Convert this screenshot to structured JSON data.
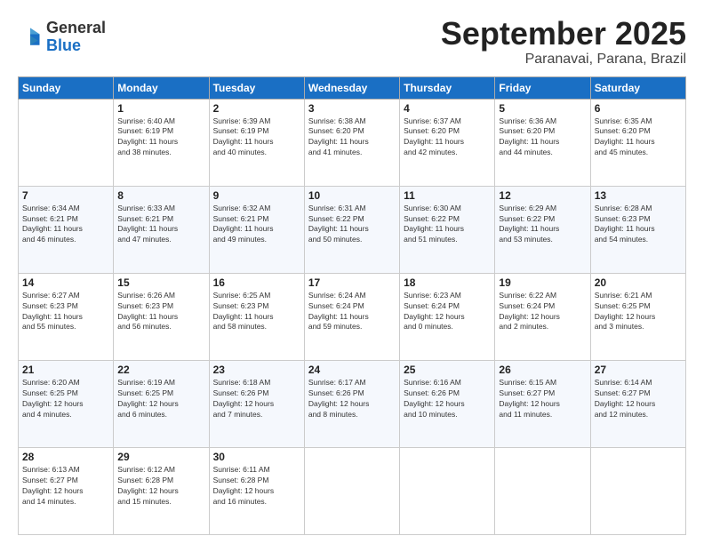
{
  "logo": {
    "general": "General",
    "blue": "Blue"
  },
  "header": {
    "month": "September 2025",
    "location": "Paranavai, Parana, Brazil"
  },
  "weekdays": [
    "Sunday",
    "Monday",
    "Tuesday",
    "Wednesday",
    "Thursday",
    "Friday",
    "Saturday"
  ],
  "weeks": [
    [
      {
        "day": "",
        "sunrise": "",
        "sunset": "",
        "daylight": ""
      },
      {
        "day": "1",
        "sunrise": "Sunrise: 6:40 AM",
        "sunset": "Sunset: 6:19 PM",
        "daylight": "Daylight: 11 hours and 38 minutes."
      },
      {
        "day": "2",
        "sunrise": "Sunrise: 6:39 AM",
        "sunset": "Sunset: 6:19 PM",
        "daylight": "Daylight: 11 hours and 40 minutes."
      },
      {
        "day": "3",
        "sunrise": "Sunrise: 6:38 AM",
        "sunset": "Sunset: 6:20 PM",
        "daylight": "Daylight: 11 hours and 41 minutes."
      },
      {
        "day": "4",
        "sunrise": "Sunrise: 6:37 AM",
        "sunset": "Sunset: 6:20 PM",
        "daylight": "Daylight: 11 hours and 42 minutes."
      },
      {
        "day": "5",
        "sunrise": "Sunrise: 6:36 AM",
        "sunset": "Sunset: 6:20 PM",
        "daylight": "Daylight: 11 hours and 44 minutes."
      },
      {
        "day": "6",
        "sunrise": "Sunrise: 6:35 AM",
        "sunset": "Sunset: 6:20 PM",
        "daylight": "Daylight: 11 hours and 45 minutes."
      }
    ],
    [
      {
        "day": "7",
        "sunrise": "Sunrise: 6:34 AM",
        "sunset": "Sunset: 6:21 PM",
        "daylight": "Daylight: 11 hours and 46 minutes."
      },
      {
        "day": "8",
        "sunrise": "Sunrise: 6:33 AM",
        "sunset": "Sunset: 6:21 PM",
        "daylight": "Daylight: 11 hours and 47 minutes."
      },
      {
        "day": "9",
        "sunrise": "Sunrise: 6:32 AM",
        "sunset": "Sunset: 6:21 PM",
        "daylight": "Daylight: 11 hours and 49 minutes."
      },
      {
        "day": "10",
        "sunrise": "Sunrise: 6:31 AM",
        "sunset": "Sunset: 6:22 PM",
        "daylight": "Daylight: 11 hours and 50 minutes."
      },
      {
        "day": "11",
        "sunrise": "Sunrise: 6:30 AM",
        "sunset": "Sunset: 6:22 PM",
        "daylight": "Daylight: 11 hours and 51 minutes."
      },
      {
        "day": "12",
        "sunrise": "Sunrise: 6:29 AM",
        "sunset": "Sunset: 6:22 PM",
        "daylight": "Daylight: 11 hours and 53 minutes."
      },
      {
        "day": "13",
        "sunrise": "Sunrise: 6:28 AM",
        "sunset": "Sunset: 6:23 PM",
        "daylight": "Daylight: 11 hours and 54 minutes."
      }
    ],
    [
      {
        "day": "14",
        "sunrise": "Sunrise: 6:27 AM",
        "sunset": "Sunset: 6:23 PM",
        "daylight": "Daylight: 11 hours and 55 minutes."
      },
      {
        "day": "15",
        "sunrise": "Sunrise: 6:26 AM",
        "sunset": "Sunset: 6:23 PM",
        "daylight": "Daylight: 11 hours and 56 minutes."
      },
      {
        "day": "16",
        "sunrise": "Sunrise: 6:25 AM",
        "sunset": "Sunset: 6:23 PM",
        "daylight": "Daylight: 11 hours and 58 minutes."
      },
      {
        "day": "17",
        "sunrise": "Sunrise: 6:24 AM",
        "sunset": "Sunset: 6:24 PM",
        "daylight": "Daylight: 11 hours and 59 minutes."
      },
      {
        "day": "18",
        "sunrise": "Sunrise: 6:23 AM",
        "sunset": "Sunset: 6:24 PM",
        "daylight": "Daylight: 12 hours and 0 minutes."
      },
      {
        "day": "19",
        "sunrise": "Sunrise: 6:22 AM",
        "sunset": "Sunset: 6:24 PM",
        "daylight": "Daylight: 12 hours and 2 minutes."
      },
      {
        "day": "20",
        "sunrise": "Sunrise: 6:21 AM",
        "sunset": "Sunset: 6:25 PM",
        "daylight": "Daylight: 12 hours and 3 minutes."
      }
    ],
    [
      {
        "day": "21",
        "sunrise": "Sunrise: 6:20 AM",
        "sunset": "Sunset: 6:25 PM",
        "daylight": "Daylight: 12 hours and 4 minutes."
      },
      {
        "day": "22",
        "sunrise": "Sunrise: 6:19 AM",
        "sunset": "Sunset: 6:25 PM",
        "daylight": "Daylight: 12 hours and 6 minutes."
      },
      {
        "day": "23",
        "sunrise": "Sunrise: 6:18 AM",
        "sunset": "Sunset: 6:26 PM",
        "daylight": "Daylight: 12 hours and 7 minutes."
      },
      {
        "day": "24",
        "sunrise": "Sunrise: 6:17 AM",
        "sunset": "Sunset: 6:26 PM",
        "daylight": "Daylight: 12 hours and 8 minutes."
      },
      {
        "day": "25",
        "sunrise": "Sunrise: 6:16 AM",
        "sunset": "Sunset: 6:26 PM",
        "daylight": "Daylight: 12 hours and 10 minutes."
      },
      {
        "day": "26",
        "sunrise": "Sunrise: 6:15 AM",
        "sunset": "Sunset: 6:27 PM",
        "daylight": "Daylight: 12 hours and 11 minutes."
      },
      {
        "day": "27",
        "sunrise": "Sunrise: 6:14 AM",
        "sunset": "Sunset: 6:27 PM",
        "daylight": "Daylight: 12 hours and 12 minutes."
      }
    ],
    [
      {
        "day": "28",
        "sunrise": "Sunrise: 6:13 AM",
        "sunset": "Sunset: 6:27 PM",
        "daylight": "Daylight: 12 hours and 14 minutes."
      },
      {
        "day": "29",
        "sunrise": "Sunrise: 6:12 AM",
        "sunset": "Sunset: 6:28 PM",
        "daylight": "Daylight: 12 hours and 15 minutes."
      },
      {
        "day": "30",
        "sunrise": "Sunrise: 6:11 AM",
        "sunset": "Sunset: 6:28 PM",
        "daylight": "Daylight: 12 hours and 16 minutes."
      },
      {
        "day": "",
        "sunrise": "",
        "sunset": "",
        "daylight": ""
      },
      {
        "day": "",
        "sunrise": "",
        "sunset": "",
        "daylight": ""
      },
      {
        "day": "",
        "sunrise": "",
        "sunset": "",
        "daylight": ""
      },
      {
        "day": "",
        "sunrise": "",
        "sunset": "",
        "daylight": ""
      }
    ]
  ]
}
